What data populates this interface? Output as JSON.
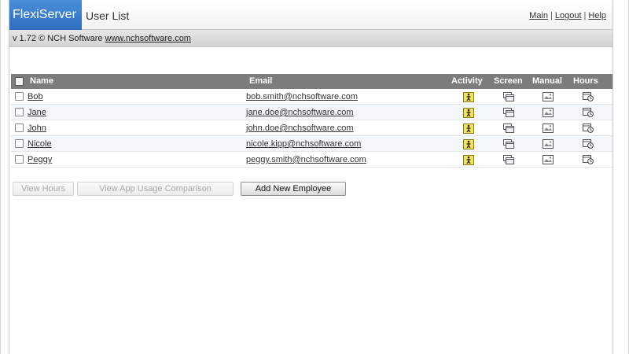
{
  "app": {
    "brand": "FlexiServer",
    "page_title": "User List"
  },
  "top_links": {
    "main": "Main",
    "logout": "Logout",
    "help": "Help",
    "separator": "|"
  },
  "version_bar": {
    "text": "v 1.72 © NCH Software ",
    "link": "www.nchsoftware.com"
  },
  "table": {
    "headers": {
      "name": "Name",
      "email": "Email",
      "activity": "Activity",
      "screen": "Screen",
      "manual": "Manual",
      "hours": "Hours"
    },
    "rows": [
      {
        "name": "Bob",
        "email": "bob.smith@nchsoftware.com"
      },
      {
        "name": "Jane",
        "email": "jane.doe@nchsoftware.com"
      },
      {
        "name": "John",
        "email": "john.doe@nchsoftware.com"
      },
      {
        "name": "Nicole",
        "email": "nicole.kipp@nchsoftware.com"
      },
      {
        "name": "Peggy",
        "email": "peggy.smith@nchsoftware.com"
      }
    ],
    "icons": {
      "activity": "activity-person-icon",
      "screen": "screen-windows-icon",
      "manual": "manual-picture-icon",
      "hours": "hours-clock-icon"
    }
  },
  "buttons": {
    "view_hours": "View Hours",
    "view_app_usage": "View App Usage Comparison",
    "add_employee": "Add New Employee"
  },
  "colors": {
    "brand_blue": "#3a7fcf",
    "header_gray": "#7c7c7c",
    "row_alt": "#f4f8fa",
    "activity_yellow": "#f2e35a"
  }
}
